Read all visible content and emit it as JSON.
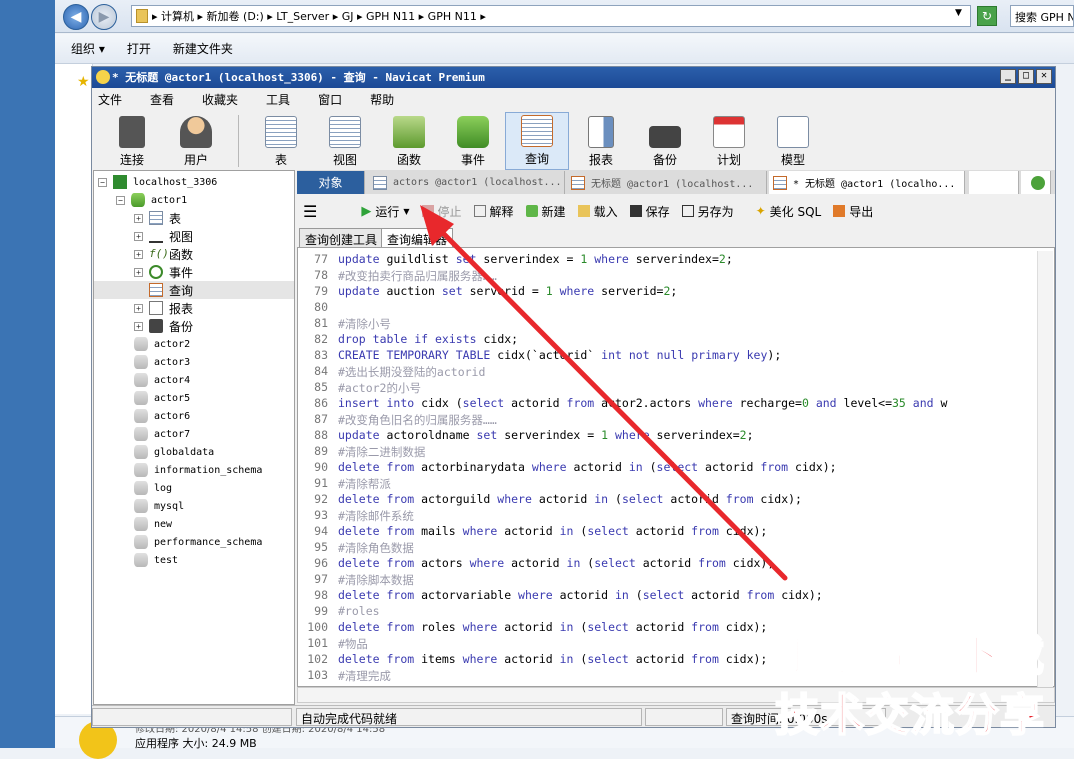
{
  "explorer": {
    "path": "▸ 计算机 ▸ 新加卷 (D:) ▸ LT_Server ▸ GJ ▸ GPH N11 ▸ GPH N11 ▸",
    "search_placeholder": "搜索 GPH N11",
    "toolbar": [
      "组织 ▾",
      "打开",
      "新建文件夹"
    ],
    "bottom_line1": "修改日期: 2020/8/4 14:58     创建日期: 2020/8/4 14:58",
    "bottom_line2": "应用程序        大小: 24.9 MB"
  },
  "window": {
    "title": "* 无标题 @actor1 (localhost_3306) - 查询 - Navicat Premium",
    "controls": [
      "_",
      "□",
      "✕"
    ]
  },
  "menu": [
    "文件",
    "查看",
    "收藏夹",
    "工具",
    "窗口",
    "帮助"
  ],
  "toolbar": {
    "connect": "连接",
    "user": "用户",
    "tools": [
      "表",
      "视图",
      "函数",
      "事件",
      "查询",
      "报表",
      "备份",
      "计划",
      "模型"
    ]
  },
  "tree": {
    "connection": "localhost_3306",
    "db_open": "actor1",
    "children": [
      "表",
      "视图",
      "函数",
      "事件",
      "查询",
      "报表",
      "备份"
    ],
    "selected": "查询",
    "databases": [
      "actor2",
      "actor3",
      "actor4",
      "actor5",
      "actor6",
      "actor7",
      "globaldata",
      "information_schema",
      "log",
      "mysql",
      "new",
      "performance_schema",
      "test"
    ]
  },
  "tabs": {
    "objects": "对象",
    "items": [
      "actors @actor1 (localhost...",
      "无标题 @actor1 (localhost...",
      "* 无标题 @actor1 (localho..."
    ]
  },
  "query_toolbar": {
    "run": "运行",
    "stop": "停止",
    "explain": "解释",
    "new": "新建",
    "load": "载入",
    "save": "保存",
    "save_as": "另存为",
    "beautify": "美化 SQL",
    "export": "导出"
  },
  "subtabs": [
    "查询创建工具",
    "查询编辑器"
  ],
  "code": [
    {
      "n": "77",
      "t": "update guildlist set serverindex = 1 where serverindex=2;"
    },
    {
      "n": "78",
      "t": "#改变拍卖行商品归属服务器……"
    },
    {
      "n": "79",
      "t": "update auction set serverid = 1 where serverid=2;"
    },
    {
      "n": "80",
      "t": ""
    },
    {
      "n": "81",
      "t": "#清除小号"
    },
    {
      "n": "82",
      "t": "drop table if exists cidx;"
    },
    {
      "n": "83",
      "t": "CREATE TEMPORARY TABLE cidx(`actorid` int not null primary key);"
    },
    {
      "n": "84",
      "t": "#选出长期没登陆的actorid"
    },
    {
      "n": "85",
      "t": "#actor2的小号"
    },
    {
      "n": "86",
      "t": "insert into cidx (select actorid from actor2.actors where recharge=0 and level<=35 and w"
    },
    {
      "n": "87",
      "t": "#改变角色旧名的归属服务器……"
    },
    {
      "n": "88",
      "t": "update actoroldname set serverindex = 1 where serverindex=2;"
    },
    {
      "n": "89",
      "t": "#清除二进制数据"
    },
    {
      "n": "90",
      "t": "delete from actorbinarydata where actorid in (select actorid from cidx);"
    },
    {
      "n": "91",
      "t": "#清除帮派"
    },
    {
      "n": "92",
      "t": "delete from actorguild where actorid in (select actorid from cidx);"
    },
    {
      "n": "93",
      "t": "#清除邮件系统"
    },
    {
      "n": "94",
      "t": "delete from mails where actorid in (select actorid from cidx);"
    },
    {
      "n": "95",
      "t": "#清除角色数据"
    },
    {
      "n": "96",
      "t": "delete from actors where actorid in (select actorid from cidx);"
    },
    {
      "n": "97",
      "t": "#清除脚本数据"
    },
    {
      "n": "98",
      "t": "delete from actorvariable where actorid in (select actorid from cidx);"
    },
    {
      "n": "99",
      "t": "#roles"
    },
    {
      "n": "100",
      "t": "delete from roles where actorid in (select actorid from cidx);"
    },
    {
      "n": "101",
      "t": "#物品"
    },
    {
      "n": "102",
      "t": "delete from items where actorid in (select actorid from cidx);"
    },
    {
      "n": "103",
      "t": "#清理完成"
    }
  ],
  "status": {
    "left": "自动完成代码就绪",
    "query_time": "查询时间: 0.000s"
  },
  "watermark": {
    "line1": "手游资源下载",
    "line2": "技术交流分享"
  },
  "colors": {
    "titlebar": "#1c4a96",
    "active_tab": "#2c5f9e",
    "keyword": "#3a3ab0",
    "number": "#2a8a2a",
    "comment": "#9a9aaa",
    "arrow": "#e8282c",
    "watermark": "#e8202a"
  }
}
